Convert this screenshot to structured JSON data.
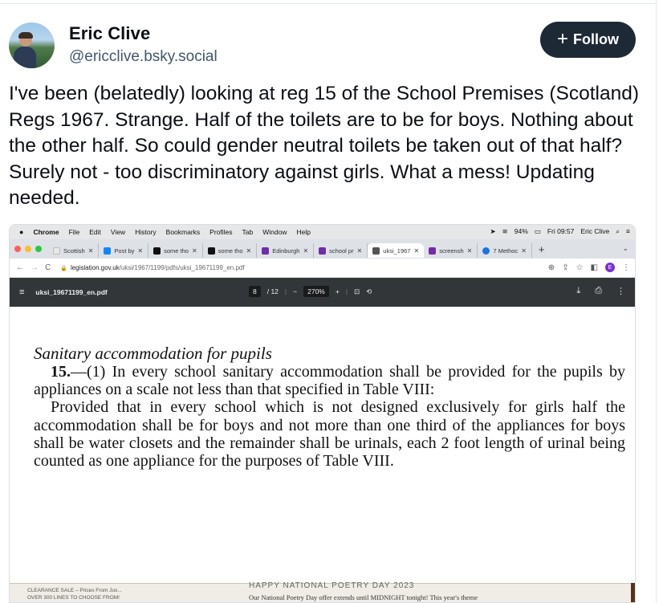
{
  "post": {
    "author_name": "Eric Clive",
    "handle": "@ericclive.bsky.social",
    "follow_label": "Follow",
    "text": "I've been (belatedly) looking at reg 15 of the School Premises (Scotland) Regs 1967. Strange. Half of the toilets are to be for boys. Nothing about the other half. So could gender neutral toilets be taken out of that half? Surely not - too discriminatory against girls. What a mess! Updating needed."
  },
  "screenshot": {
    "menubar": {
      "app": "Chrome",
      "items": [
        "File",
        "Edit",
        "View",
        "History",
        "Bookmarks",
        "Profiles",
        "Tab",
        "Window",
        "Help"
      ],
      "battery": "94%",
      "clock": "Fri 09:57",
      "user": "Eric Clive"
    },
    "tabs": [
      {
        "label": "Scottish",
        "color": "#e8e8e8"
      },
      {
        "label": "Post by",
        "color": "#1185fe"
      },
      {
        "label": "some tho",
        "color": "#111111"
      },
      {
        "label": "some tho",
        "color": "#111111"
      },
      {
        "label": "Edinburgh",
        "color": "#6f2da8"
      },
      {
        "label": "school pr",
        "color": "#6f2da8"
      },
      {
        "label": "uksi_1967",
        "color": "#555555"
      },
      {
        "label": "screensh",
        "color": "#6f2da8"
      },
      {
        "label": "7 Methoc",
        "color": "#1a73e8"
      }
    ],
    "active_tab_index": 6,
    "url": {
      "domain": "legislation.gov.uk",
      "path": "/uksi/1967/1199/pdfs/uksi_19671199_en.pdf"
    },
    "profile_initial": "E",
    "pdf_toolbar": {
      "filename": "uksi_19671199_en.pdf",
      "page_current": "8",
      "page_total": "/ 12",
      "zoom": "270%"
    },
    "document": {
      "heading": "Sanitary accommodation for pupils",
      "reg_number": "15.",
      "para1": "—(1) In every school sanitary accommodation shall be provided for the pupils by appliances on a scale not less than that specified in Table VIII:",
      "para2": "Provided that in every school which is not designed exclusively for girls half the accommodation shall be for boys and not more than one third of the appliances for boys shall be water closets and the remainder shall be urinals, each 2 foot length of urinal being counted as one appliance for the purposes of Table VIII."
    },
    "overlay": {
      "ad_line1": "CLEARANCE SALE – Prices From Jus...",
      "ad_line2": "OVER 300 LINES TO CHOOSE FROM!",
      "poetry_heading": "HAPPY NATIONAL POETRY DAY 2023",
      "poetry_line": "Our National Poetry Day offer extends until MIDNIGHT tonight! This year's theme"
    }
  }
}
